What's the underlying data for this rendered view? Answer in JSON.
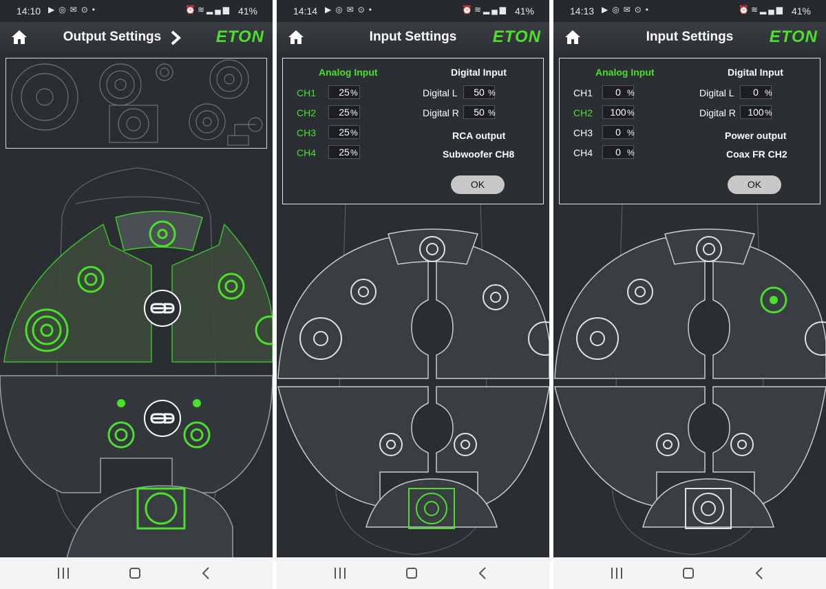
{
  "colors": {
    "accent_green": "#4be02c",
    "background": "#2a2d31",
    "text": "#ffffff",
    "nav_background": "#f4f4f4"
  },
  "screens": [
    {
      "status": {
        "time": "14:10",
        "battery": "41%"
      },
      "header": {
        "title": "Output Settings",
        "logo": "ETON"
      },
      "icons": [
        "home-icon",
        "chevron-right-icon",
        "link-icon"
      ]
    },
    {
      "status": {
        "time": "14:14",
        "battery": "41%"
      },
      "header": {
        "title": "Input Settings",
        "logo": "ETON"
      },
      "dialog": {
        "analog_title": "Analog Input",
        "digital_title": "Digital Input",
        "channels": [
          {
            "label": "CH1",
            "value": "25",
            "unit": "%",
            "active": true
          },
          {
            "label": "CH2",
            "value": "25",
            "unit": "%",
            "active": true
          },
          {
            "label": "CH3",
            "value": "25",
            "unit": "%",
            "active": true
          },
          {
            "label": "CH4",
            "value": "25",
            "unit": "%",
            "active": true
          }
        ],
        "digital": [
          {
            "label": "Digital L",
            "value": "50",
            "unit": "%"
          },
          {
            "label": "Digital R",
            "value": "50",
            "unit": "%"
          }
        ],
        "output_type": "RCA output",
        "output_channel": "Subwoofer CH8",
        "ok_label": "OK"
      }
    },
    {
      "status": {
        "time": "14:13",
        "battery": "41%"
      },
      "header": {
        "title": "Input Settings",
        "logo": "ETON"
      },
      "dialog": {
        "analog_title": "Analog Input",
        "digital_title": "Digital Input",
        "channels": [
          {
            "label": "CH1",
            "value": "0",
            "unit": "%",
            "active": false
          },
          {
            "label": "CH2",
            "value": "100",
            "unit": "%",
            "active": true
          },
          {
            "label": "CH3",
            "value": "0",
            "unit": "%",
            "active": false
          },
          {
            "label": "CH4",
            "value": "0",
            "unit": "%",
            "active": false
          }
        ],
        "digital": [
          {
            "label": "Digital L",
            "value": "0",
            "unit": "%"
          },
          {
            "label": "Digital R",
            "value": "100",
            "unit": "%"
          }
        ],
        "output_type": "Power output",
        "output_channel": "Coax FR CH2",
        "ok_label": "OK"
      }
    }
  ]
}
